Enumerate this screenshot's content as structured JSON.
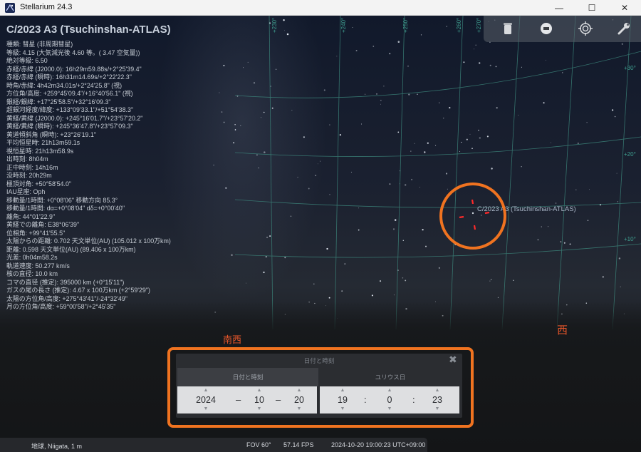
{
  "window": {
    "title": "Stellarium 24.3",
    "controls": {
      "minimize": "—",
      "maximize": "☐",
      "close": "✕"
    }
  },
  "object": {
    "name": "C/2023 A3 (Tsuchinshan-ATLAS)",
    "sky_label": "C/2023 A3 (Tsuchinshan-ATLAS)"
  },
  "info_lines": [
    "種類: 彗星 (非周期彗星)",
    "等級: 4.15 (大気減光後 4.60 等。( 3.47 空気量))",
    "絶対等級: 6.50",
    "赤経/赤緯 (J2000.0): 16h29m59.88s/+2°25'39.4\"",
    "赤経/赤緯 (瞬時): 16h31m14.69s/+2°22'22.3\"",
    "時角/赤緯: 4h42m34.01s/+2°24'25.8\" (視)",
    "方位角/高度: +259°45'09.4\"/+16°40'56.1\" (視)",
    "銀経/銀緯: +17°25'58.5\"/+32°16'09.3\"",
    "超銀河経度/緯度: +133°09'33.1\"/+51°54'38.3\"",
    "黄経/黄緯 (J2000.0): +245°16'01.7\"/+23°57'20.2\"",
    "黄経/黄緯 (瞬時): +245°36'47.8\"/+23°57'09.3\"",
    "黄道傾斜角 (瞬時): +23°26'19.1\"",
    "平均恒星時: 21h13m59.1s",
    "視恒星時: 21h13m58.9s",
    "出時刻: 8h04m",
    "正中時刻: 14h16m",
    "没時刻: 20h29m",
    "極頂対角: +50°58'54.0\"",
    "IAU星座: Oph",
    "移動量/1時間: +0°08'06\" 移動方向 85.3°",
    "移動量/1時間: dα=+0°08'04\" dδ=+0°00'40\"",
    "離角: 44°01'22.9\"",
    "黄経での離角: E38°06'39\"",
    "位相角: +99°41'55.5\"",
    "太陽からの距離: 0.702 天文単位(AU) (105.012 x 100万km)",
    "距離: 0.598 天文単位(AU) (89.406 x 100万km)",
    "光差: 0h04m58.2s",
    "軌道速度: 50.277 km/s",
    "核の直径: 10.0 km",
    "コマの直径 (推定): 395000 km (+0°15'11\")",
    "ガスの尾の長さ (推定): 4.67 x 100万km (+2°59'29\")",
    "太陽の方位角/高度: +275°43'41\"/-24°32'49\"",
    "月の方位角/高度: +59°00'58\"/+2°45'35\""
  ],
  "grid_labels": {
    "top": [
      "+230°",
      "+240°",
      "+250°",
      "+260°",
      "+270°"
    ],
    "right": [
      "+30°",
      "+20°",
      "+10°"
    ]
  },
  "directions": {
    "southwest": "南西",
    "west": "西"
  },
  "toolbar": {
    "icons": [
      "trash-icon",
      "stop-icon",
      "target-icon",
      "wrench-icon"
    ]
  },
  "dialog": {
    "title": "日付と時刻",
    "close": "✖",
    "tabs": [
      "日付と時刻",
      "ユリウス日"
    ],
    "date": {
      "year": "2024",
      "month": "10",
      "day": "20",
      "separator": "–"
    },
    "time": {
      "hour": "19",
      "minute": "0",
      "second": "23",
      "separator": ":"
    }
  },
  "status": {
    "location": "地球, Niigata, 1 m",
    "fov": "FOV 60°",
    "fps": "57.14 FPS",
    "datetime": "2024-10-20 19:00:23 UTC+09:00"
  },
  "colors": {
    "accent_highlight": "#f07320",
    "direction_text": "#e8562a",
    "grid_line": "#3f8f82"
  }
}
